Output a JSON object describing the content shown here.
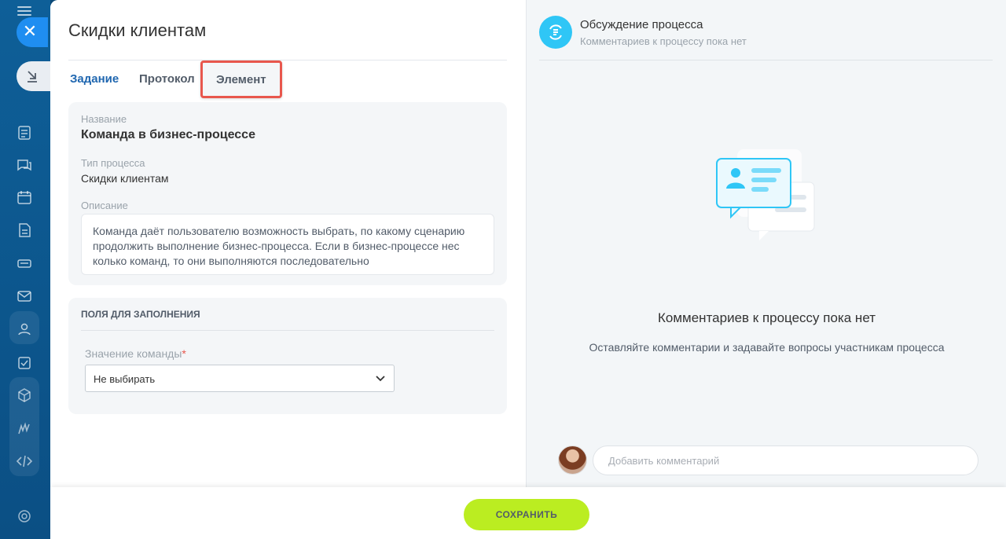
{
  "page": {
    "title": "Скидки клиентам"
  },
  "tabs": [
    {
      "label": "Задание",
      "active": true
    },
    {
      "label": "Протокол",
      "active": false
    },
    {
      "label": "Элемент",
      "active": false,
      "highlighted": true
    }
  ],
  "info": {
    "name_label": "Название",
    "name_value": "Команда в бизнес-процессе",
    "type_label": "Тип процесса",
    "type_value": "Скидки клиентам",
    "desc_label": "Описание",
    "desc_value": "Команда даёт пользователю возможность выбрать, по какому сценарию продолжить выполнение бизнес-процесса. Если в бизнес-процессе нес колько команд, то они выполняются последовательно"
  },
  "fields": {
    "section_title": "ПОЛЯ ДЛЯ ЗАПОЛНЕНИЯ",
    "command_label": "Значение команды",
    "required_mark": "*",
    "command_value": "Не выбирать"
  },
  "discussion": {
    "title": "Обсуждение процесса",
    "subtitle": "Комментариев к процессу пока нет",
    "empty_title": "Комментариев к процессу пока нет",
    "empty_text": "Оставляйте комментарии и задавайте вопросы участникам процесса",
    "input_placeholder": "Добавить комментарий"
  },
  "footer": {
    "save_label": "СОХРАНИТЬ"
  },
  "colors": {
    "accent": "#2067b0",
    "save_button": "#bbed21",
    "highlight": "#e8574d",
    "chat_icon": "#2fc6f6"
  }
}
